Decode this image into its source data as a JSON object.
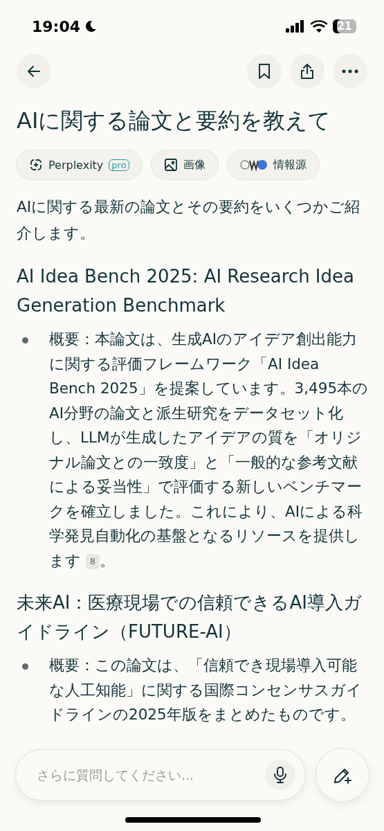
{
  "status_bar": {
    "time": "19:04",
    "battery": "21"
  },
  "title": "AIに関する論文と要約を教えて",
  "chips": [
    {
      "kind": "model",
      "label": "Perplexity",
      "badge": "pro"
    },
    {
      "kind": "images",
      "label": "画像"
    },
    {
      "kind": "sources",
      "label": "情報源"
    }
  ],
  "intro": "AIに関する最新の論文とその要約をいくつかご紹介します。",
  "sections": [
    {
      "heading": "AI Idea Bench 2025: AI Research Idea Generation Benchmark",
      "bullets": [
        {
          "text": "概要：本論文は、生成AIのアイデア創出能力に関する評価フレームワーク「AI Idea Bench 2025」を提案しています。3,495本のAI分野の論文と派生研究をデータセット化し、LLMが生成したアイデアの質を「オリジナル論文との一致度」と「一般的な参考文献による妥当性」で評価する新しいベンチマークを確立しました。これにより、AIによる科学発見自動化の基盤となるリソースを提供します",
          "citation": "8",
          "after": "。"
        }
      ]
    },
    {
      "heading": "未来AI：医療現場での信頼できるAI導入ガイドライン（FUTURE-AI）",
      "bullets": [
        {
          "text": "概要：この論文は、「信頼でき現場導入可能な人工知能」に関する国際コンセンサスガイドラインの2025年版をまとめたものです。"
        }
      ]
    }
  ],
  "composer": {
    "placeholder": "さらに質問してください..."
  }
}
